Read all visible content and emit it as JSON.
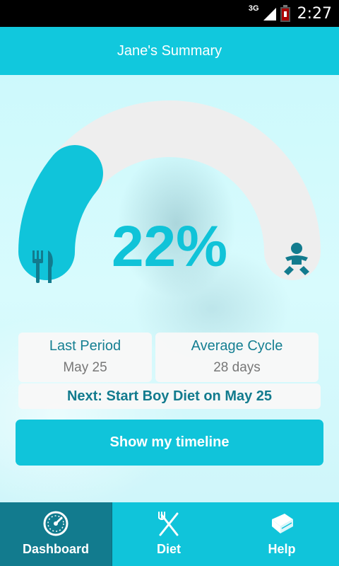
{
  "status_bar": {
    "network": "3G",
    "time": "2:27"
  },
  "header": {
    "title": "Jane's Summary"
  },
  "progress": {
    "percent_label": "22%",
    "percent_value": 0.22
  },
  "icons": {
    "left": "fork-knife-icon",
    "right": "baby-icon"
  },
  "stats": {
    "last_period": {
      "label": "Last Period",
      "value": "May 25"
    },
    "average_cycle": {
      "label": "Average Cycle",
      "value": "28 days"
    }
  },
  "next_step": "Next: Start Boy Diet on May 25",
  "timeline_button": "Show my timeline",
  "nav": {
    "items": [
      {
        "label": "Dashboard",
        "icon": "speedometer-icon",
        "active": true
      },
      {
        "label": "Diet",
        "icon": "fork-knife-icon",
        "active": false
      },
      {
        "label": "Help",
        "icon": "book-icon",
        "active": false
      }
    ]
  },
  "colors": {
    "primary": "#10c4da",
    "primary_dark": "#127b8e",
    "gauge_track": "#eeeeee",
    "background": "#d2fbff"
  }
}
